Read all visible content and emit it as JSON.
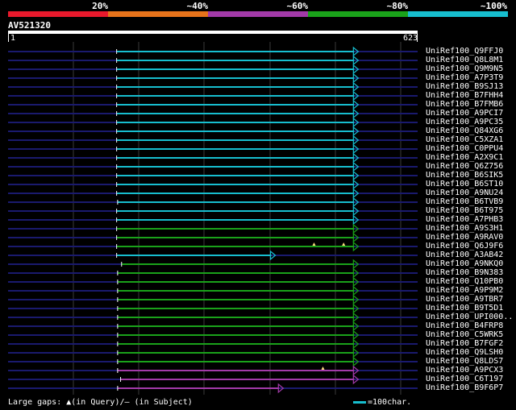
{
  "legend": {
    "colors": [
      "#e8192c",
      "#e6731b",
      "#a23aa8",
      "#1aa21a",
      "#17becf"
    ],
    "labels": [
      "20%",
      "~40%",
      "~60%",
      "~80%",
      "~100%"
    ]
  },
  "query": {
    "id": "AV521320",
    "start": "1",
    "end": "623",
    "length": 623
  },
  "hits": [
    {
      "name": "UniRef100_Q9FFJ0",
      "start": 220,
      "end": 708,
      "identity": "~100%",
      "gaps_query": [],
      "gaps_subject": []
    },
    {
      "name": "UniRef100_Q8L8M1",
      "start": 220,
      "end": 708,
      "identity": "~100%",
      "gaps_query": [],
      "gaps_subject": []
    },
    {
      "name": "UniRef100_Q9M9N5",
      "start": 220,
      "end": 708,
      "identity": "~100%",
      "gaps_query": [],
      "gaps_subject": []
    },
    {
      "name": "UniRef100_A7P3T9",
      "start": 220,
      "end": 708,
      "identity": "~100%",
      "gaps_query": [],
      "gaps_subject": []
    },
    {
      "name": "UniRef100_B9SJ13",
      "start": 220,
      "end": 708,
      "identity": "~100%",
      "gaps_query": [],
      "gaps_subject": []
    },
    {
      "name": "UniRef100_B7FHH4",
      "start": 220,
      "end": 708,
      "identity": "~100%",
      "gaps_query": [],
      "gaps_subject": []
    },
    {
      "name": "UniRef100_B7FMB6",
      "start": 220,
      "end": 708,
      "identity": "~100%",
      "gaps_query": [],
      "gaps_subject": []
    },
    {
      "name": "UniRef100_A9PCI7",
      "start": 220,
      "end": 708,
      "identity": "~100%",
      "gaps_query": [],
      "gaps_subject": []
    },
    {
      "name": "UniRef100_A9PC35",
      "start": 220,
      "end": 708,
      "identity": "~100%",
      "gaps_query": [],
      "gaps_subject": []
    },
    {
      "name": "UniRef100_Q84XG6",
      "start": 220,
      "end": 708,
      "identity": "~100%",
      "gaps_query": [],
      "gaps_subject": []
    },
    {
      "name": "UniRef100_C5XZA1",
      "start": 220,
      "end": 708,
      "identity": "~100%",
      "gaps_query": [],
      "gaps_subject": []
    },
    {
      "name": "UniRef100_C0PPU4",
      "start": 220,
      "end": 708,
      "identity": "~100%",
      "gaps_query": [],
      "gaps_subject": []
    },
    {
      "name": "UniRef100_A2X9C1",
      "start": 220,
      "end": 708,
      "identity": "~100%",
      "gaps_query": [],
      "gaps_subject": []
    },
    {
      "name": "UniRef100_Q6Z756",
      "start": 220,
      "end": 708,
      "identity": "~100%",
      "gaps_query": [],
      "gaps_subject": []
    },
    {
      "name": "UniRef100_B6SIK5",
      "start": 220,
      "end": 708,
      "identity": "~100%",
      "gaps_query": [],
      "gaps_subject": []
    },
    {
      "name": "UniRef100_B6ST10",
      "start": 220,
      "end": 708,
      "identity": "~100%",
      "gaps_query": [],
      "gaps_subject": []
    },
    {
      "name": "UniRef100_A9NU24",
      "start": 220,
      "end": 708,
      "identity": "~100%",
      "gaps_query": [],
      "gaps_subject": []
    },
    {
      "name": "UniRef100_B6TVB9",
      "start": 222,
      "end": 708,
      "identity": "~100%",
      "gaps_query": [],
      "gaps_subject": []
    },
    {
      "name": "UniRef100_B6T975",
      "start": 220,
      "end": 708,
      "identity": "~100%",
      "gaps_query": [],
      "gaps_subject": []
    },
    {
      "name": "UniRef100_A7PHB3",
      "start": 220,
      "end": 708,
      "identity": "~100%",
      "gaps_query": [],
      "gaps_subject": []
    },
    {
      "name": "UniRef100_A9S3H1",
      "start": 220,
      "end": 708,
      "identity": "~80%",
      "gaps_query": [],
      "gaps_subject": []
    },
    {
      "name": "UniRef100_A9RAV0",
      "start": 220,
      "end": 708,
      "identity": "~80%",
      "gaps_query": [],
      "gaps_subject": []
    },
    {
      "name": "UniRef100_Q6J9F6",
      "start": 220,
      "end": 708,
      "identity": "~80%",
      "gaps_query": [
        620,
        680
      ],
      "gaps_subject": []
    },
    {
      "name": "UniRef100_A3AB42",
      "start": 220,
      "end": 540,
      "identity": "~100%",
      "gaps_query": [],
      "gaps_subject": []
    },
    {
      "name": "UniRef100_A9NKQ0",
      "start": 230,
      "end": 708,
      "identity": "~80%",
      "gaps_query": [],
      "gaps_subject": []
    },
    {
      "name": "UniRef100_B9N383",
      "start": 222,
      "end": 708,
      "identity": "~80%",
      "gaps_query": [],
      "gaps_subject": []
    },
    {
      "name": "UniRef100_Q10PB0",
      "start": 222,
      "end": 708,
      "identity": "~80%",
      "gaps_query": [],
      "gaps_subject": []
    },
    {
      "name": "UniRef100_A9P9M2",
      "start": 222,
      "end": 708,
      "identity": "~80%",
      "gaps_query": [],
      "gaps_subject": []
    },
    {
      "name": "UniRef100_A9TBR7",
      "start": 222,
      "end": 708,
      "identity": "~80%",
      "gaps_query": [],
      "gaps_subject": []
    },
    {
      "name": "UniRef100_B9T5D1",
      "start": 222,
      "end": 708,
      "identity": "~80%",
      "gaps_query": [],
      "gaps_subject": []
    },
    {
      "name": "UniRef100_UPI000..",
      "start": 222,
      "end": 708,
      "identity": "~80%",
      "gaps_query": [],
      "gaps_subject": []
    },
    {
      "name": "UniRef100_B4FRP8",
      "start": 222,
      "end": 708,
      "identity": "~80%",
      "gaps_query": [],
      "gaps_subject": []
    },
    {
      "name": "UniRef100_C5WRK5",
      "start": 222,
      "end": 708,
      "identity": "~80%",
      "gaps_query": [],
      "gaps_subject": []
    },
    {
      "name": "UniRef100_B7FGF2",
      "start": 222,
      "end": 708,
      "identity": "~80%",
      "gaps_query": [],
      "gaps_subject": []
    },
    {
      "name": "UniRef100_Q9LSH0",
      "start": 222,
      "end": 708,
      "identity": "~80%",
      "gaps_query": [],
      "gaps_subject": []
    },
    {
      "name": "UniRef100_Q8LDS7",
      "start": 222,
      "end": 708,
      "identity": "~80%",
      "gaps_query": [],
      "gaps_subject": []
    },
    {
      "name": "UniRef100_A9PCX3",
      "start": 222,
      "end": 708,
      "identity": "~60%",
      "gaps_query": [
        638
      ],
      "gaps_subject": []
    },
    {
      "name": "UniRef100_C6T197",
      "start": 228,
      "end": 708,
      "identity": "~60%",
      "gaps_query": [],
      "gaps_subject": []
    },
    {
      "name": "UniRef100_B9F6P7",
      "start": 222,
      "end": 556,
      "identity": "~60%",
      "gaps_query": [],
      "gaps_subject": []
    }
  ],
  "footer": {
    "text": "Large gaps: ▲(in Query)/– (in Subject)",
    "scale": "=100char."
  }
}
